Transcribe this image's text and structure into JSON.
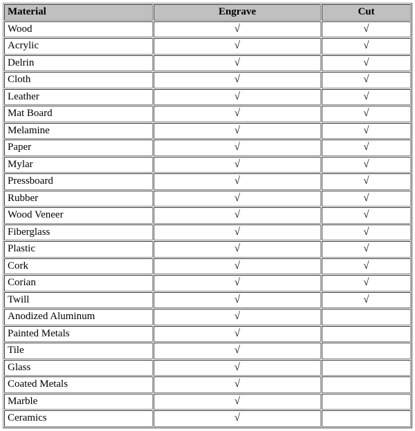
{
  "headers": {
    "material": "Material",
    "engrave": "Engrave",
    "cut": "Cut"
  },
  "check_symbol": "√",
  "rows": [
    {
      "material": "Wood",
      "engrave": true,
      "cut": true
    },
    {
      "material": "Acrylic",
      "engrave": true,
      "cut": true
    },
    {
      "material": "Delrin",
      "engrave": true,
      "cut": true
    },
    {
      "material": "Cloth",
      "engrave": true,
      "cut": true
    },
    {
      "material": "Leather",
      "engrave": true,
      "cut": true
    },
    {
      "material": "Mat Board",
      "engrave": true,
      "cut": true
    },
    {
      "material": "Melamine",
      "engrave": true,
      "cut": true
    },
    {
      "material": "Paper",
      "engrave": true,
      "cut": true
    },
    {
      "material": "Mylar",
      "engrave": true,
      "cut": true
    },
    {
      "material": "Pressboard",
      "engrave": true,
      "cut": true
    },
    {
      "material": "Rubber",
      "engrave": true,
      "cut": true
    },
    {
      "material": "Wood Veneer",
      "engrave": true,
      "cut": true
    },
    {
      "material": "Fiberglass",
      "engrave": true,
      "cut": true
    },
    {
      "material": "Plastic",
      "engrave": true,
      "cut": true
    },
    {
      "material": "Cork",
      "engrave": true,
      "cut": true
    },
    {
      "material": "Corian",
      "engrave": true,
      "cut": true
    },
    {
      "material": "Twill",
      "engrave": true,
      "cut": true
    },
    {
      "material": "Anodized Aluminum",
      "engrave": true,
      "cut": false
    },
    {
      "material": "Painted Metals",
      "engrave": true,
      "cut": false
    },
    {
      "material": "Tile",
      "engrave": true,
      "cut": false
    },
    {
      "material": "Glass",
      "engrave": true,
      "cut": false
    },
    {
      "material": "Coated Metals",
      "engrave": true,
      "cut": false
    },
    {
      "material": "Marble",
      "engrave": true,
      "cut": false
    },
    {
      "material": "Ceramics",
      "engrave": true,
      "cut": false
    }
  ]
}
